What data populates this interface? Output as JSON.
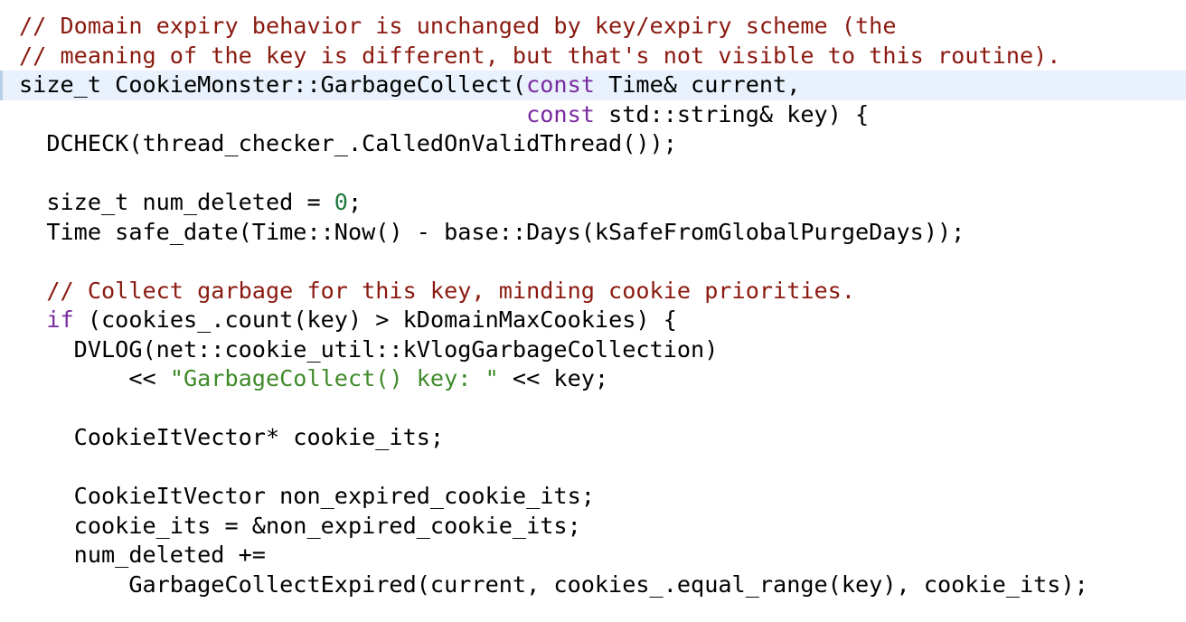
{
  "code": {
    "lines": [
      {
        "segments": [
          {
            "text": "// Domain expiry behavior is unchanged by key/expiry scheme (the",
            "cls": "cm"
          }
        ]
      },
      {
        "segments": [
          {
            "text": "// meaning of the key is different, but that's not visible to this routine).",
            "cls": "cm"
          }
        ]
      },
      {
        "highlight": true,
        "segments": [
          {
            "text": "size_t CookieMonster::GarbageCollect(",
            "cls": ""
          },
          {
            "text": "const",
            "cls": "kw"
          },
          {
            "text": " Time& current,",
            "cls": ""
          }
        ]
      },
      {
        "segments": [
          {
            "text": "                                     ",
            "cls": ""
          },
          {
            "text": "const",
            "cls": "kw"
          },
          {
            "text": " std::string& key) {",
            "cls": ""
          }
        ]
      },
      {
        "segments": [
          {
            "text": "  DCHECK(thread_checker_.CalledOnValidThread());",
            "cls": ""
          }
        ]
      },
      {
        "segments": []
      },
      {
        "segments": [
          {
            "text": "  size_t num_deleted = ",
            "cls": ""
          },
          {
            "text": "0",
            "cls": "num"
          },
          {
            "text": ";",
            "cls": ""
          }
        ]
      },
      {
        "segments": [
          {
            "text": "  Time safe_date(Time::Now() - base::Days(kSafeFromGlobalPurgeDays));",
            "cls": ""
          }
        ]
      },
      {
        "segments": []
      },
      {
        "segments": [
          {
            "text": "  // Collect garbage for this key, minding cookie priorities.",
            "cls": "cm"
          }
        ]
      },
      {
        "segments": [
          {
            "text": "  ",
            "cls": ""
          },
          {
            "text": "if",
            "cls": "kw"
          },
          {
            "text": " (cookies_.count(key) > kDomainMaxCookies) {",
            "cls": ""
          }
        ]
      },
      {
        "segments": [
          {
            "text": "    DVLOG(net::cookie_util::kVlogGarbageCollection)",
            "cls": ""
          }
        ]
      },
      {
        "segments": [
          {
            "text": "        << ",
            "cls": ""
          },
          {
            "text": "\"GarbageCollect() key: \"",
            "cls": "str"
          },
          {
            "text": " << key;",
            "cls": ""
          }
        ]
      },
      {
        "segments": []
      },
      {
        "segments": [
          {
            "text": "    CookieItVector* cookie_its;",
            "cls": ""
          }
        ]
      },
      {
        "segments": []
      },
      {
        "segments": [
          {
            "text": "    CookieItVector non_expired_cookie_its;",
            "cls": ""
          }
        ]
      },
      {
        "segments": [
          {
            "text": "    cookie_its = &non_expired_cookie_its;",
            "cls": ""
          }
        ]
      },
      {
        "segments": [
          {
            "text": "    num_deleted +=",
            "cls": ""
          }
        ]
      },
      {
        "segments": [
          {
            "text": "        GarbageCollectExpired(current, cookies_.equal_range(key), cookie_its);",
            "cls": ""
          }
        ]
      }
    ]
  }
}
